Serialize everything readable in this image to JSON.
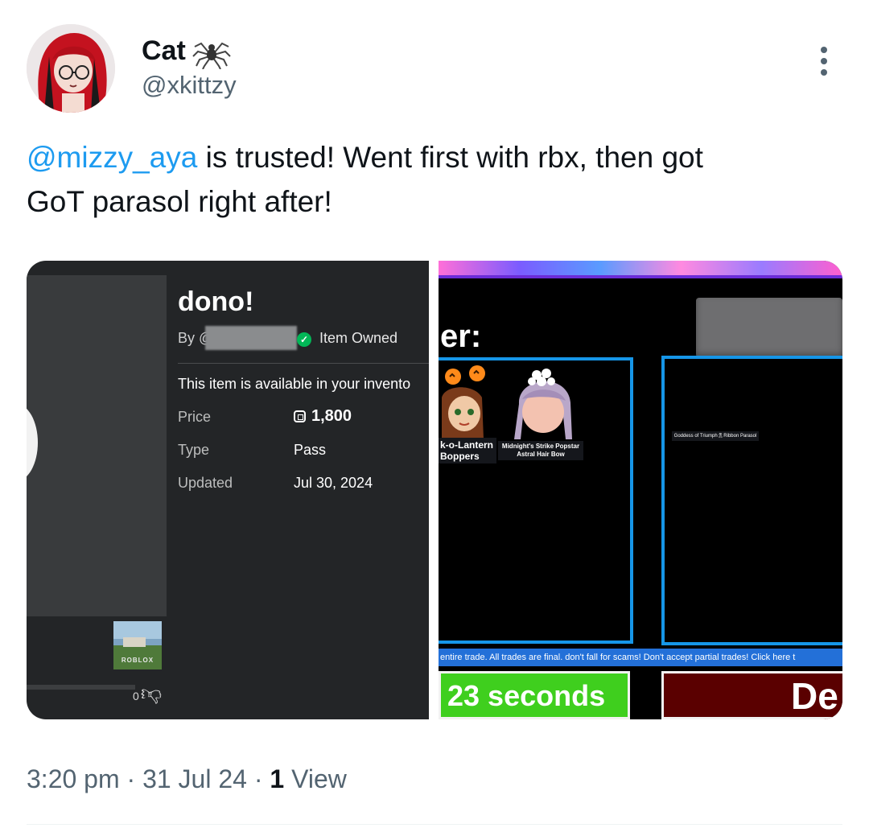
{
  "tweet": {
    "display_name": "Cat",
    "handle": "@xkittzy",
    "mention": "@mizzy_aya",
    "text_line1": " is trusted! Went first with rbx, then got",
    "text_line2": "GoT parasol right after!",
    "time": "3:20 pm",
    "sep1": " · ",
    "date": "31 Jul 24",
    "sep2": " · ",
    "views_count": "1",
    "views_label": " View"
  },
  "roblox_item": {
    "title": "dono!",
    "by_label": "By @",
    "owned_label": "Item Owned",
    "availability": "This item is available in your invento",
    "price_label": "Price",
    "price_value": "1,800",
    "type_label": "Type",
    "type_value": "Pass",
    "updated_label": "Updated",
    "updated_value": "Jul 30, 2024",
    "thumb_label": "ROBLOX",
    "dislikes": "0"
  },
  "trade_screen": {
    "header_fragment": "er:",
    "item1": "k-o-Lantern Boppers",
    "item2": "Midnight's Strike Popstar Astral Hair Bow",
    "item3": "Goddess of Triumph🎗Ribbon Parasol",
    "warning": "entire trade. All trades are final. don't fall for scams! Don't accept partial trades! Click here t",
    "timer": "23 seconds",
    "decline_fragment": "De"
  },
  "colors": {
    "link": "#1d9bf0",
    "secondary_text": "#536471",
    "trade_border": "#1696e8",
    "timer_green": "#3fcf1e",
    "decline_red": "#5a0000"
  }
}
